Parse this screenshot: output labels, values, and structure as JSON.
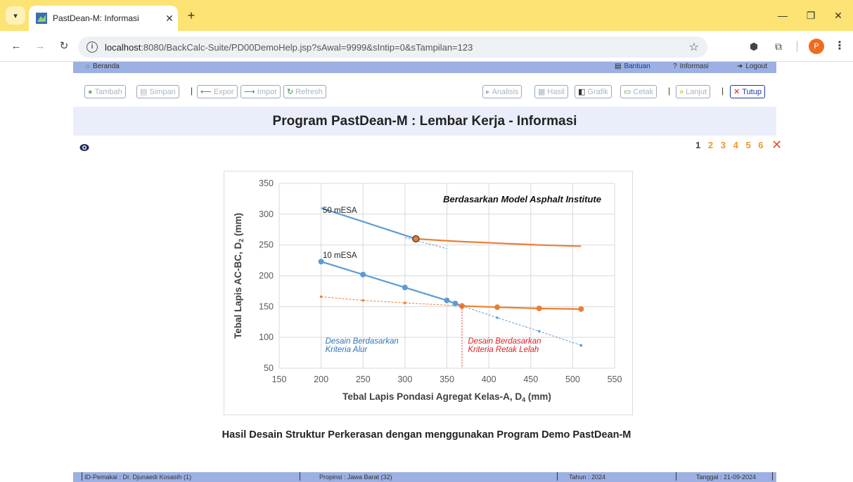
{
  "browser": {
    "tab_title": "PastDean-M: Informasi",
    "url_host": "localhost",
    "url_rest": ":8080/BackCalc-Suite/PD00DemoHelp.jsp?sAwal=9999&sIntip=0&sTampilan=123",
    "profile_initial": "P"
  },
  "topbar": {
    "home": "Beranda",
    "help": "Bantuan",
    "info": "Informasi",
    "logout": "Logout"
  },
  "toolbar": {
    "tambah": "Tambah",
    "simpan": "Simpan",
    "expor": "Expor",
    "impor": "Impor",
    "refresh": "Refresh",
    "analisis": "Analisis",
    "hasil": "Hasil",
    "grafik": "Grafik",
    "cetak": "Cetak",
    "lanjut": "Lanjut",
    "tutup": "Tutup",
    "sep": "|"
  },
  "page": {
    "title": "Program PastDean-M : Lembar Kerja - Informasi",
    "caption": "Hasil Desain Struktur Perkerasan dengan menggunakan Program Demo PastDean-M"
  },
  "pager": {
    "current": "1",
    "pages": [
      "2",
      "3",
      "4",
      "5",
      "6"
    ],
    "close": "✕"
  },
  "chart_data": {
    "type": "line",
    "title": "Berdasarkan Model Asphalt Institute",
    "xlabel": "Tebal Lapis Pondasi  Agregat Kelas-A, D",
    "xlabel_sub": "4",
    "xlabel_unit": " (mm)",
    "ylabel": "Tebal Lapis AC-BC, D",
    "ylabel_sub": "2",
    "ylabel_unit": " (mm)",
    "xlim": [
      150,
      550
    ],
    "ylim": [
      50,
      350
    ],
    "xticks": [
      150,
      200,
      250,
      300,
      350,
      400,
      450,
      500,
      550
    ],
    "yticks": [
      50,
      100,
      150,
      200,
      250,
      300,
      350
    ],
    "grid": true,
    "series": [
      {
        "name": "50 mESA",
        "color": "#5b9bd5",
        "x": [
          200,
          313
        ],
        "y": [
          310,
          260
        ]
      },
      {
        "name": "50 mESA",
        "color": "#5b9bd5",
        "dashed": true,
        "x": [
          300,
          350
        ],
        "y": [
          262,
          244
        ]
      },
      {
        "name": "50 mESA",
        "color": "#ed7d31",
        "x": [
          313,
          360,
          410,
          460,
          510
        ],
        "y": [
          260,
          256,
          253,
          250,
          248
        ]
      },
      {
        "name": "10 mESA",
        "color": "#5b9bd5",
        "markers": true,
        "x": [
          200,
          250,
          300,
          350,
          360,
          368
        ],
        "y": [
          223,
          202,
          181,
          160,
          155,
          151
        ]
      },
      {
        "name": "10 mESA",
        "color": "#5b9bd5",
        "dashed": true,
        "markers_small": true,
        "x": [
          368,
          410,
          460,
          510
        ],
        "y": [
          151,
          132,
          110,
          87
        ]
      },
      {
        "name": "10 mESA",
        "color": "#ed7d31",
        "markers": true,
        "x": [
          368,
          410,
          460,
          510
        ],
        "y": [
          151,
          149,
          147,
          146
        ]
      },
      {
        "name": "10 mESA",
        "color": "#ed7d31",
        "dashed": true,
        "markers_small": true,
        "x": [
          200,
          250,
          300,
          368
        ],
        "y": [
          166,
          160,
          156,
          151
        ]
      }
    ],
    "annotations": [
      {
        "text": "50 mESA",
        "x": 202,
        "y": 302
      },
      {
        "text": "10 mESA",
        "x": 202,
        "y": 229
      },
      {
        "text": "Desain Berdasarkan",
        "x": 205,
        "y": 90,
        "color": "#2e75b6"
      },
      {
        "text": "Kriteria Alur",
        "x": 205,
        "y": 76,
        "color": "#2e75b6"
      },
      {
        "text": "Desain Berdasarkan",
        "x": 375,
        "y": 90,
        "color": "#e02020"
      },
      {
        "text": "Kriteria Retak Lelah",
        "x": 375,
        "y": 76,
        "color": "#e02020"
      }
    ]
  },
  "footer": {
    "user": "ID-Pemakai : Dr. Djunaedi Kosasih (1)",
    "province": "Propinsi : Jawa Barat (32)",
    "year": "Tahun : 2024",
    "date": "Tanggal : 21-09-2024"
  }
}
